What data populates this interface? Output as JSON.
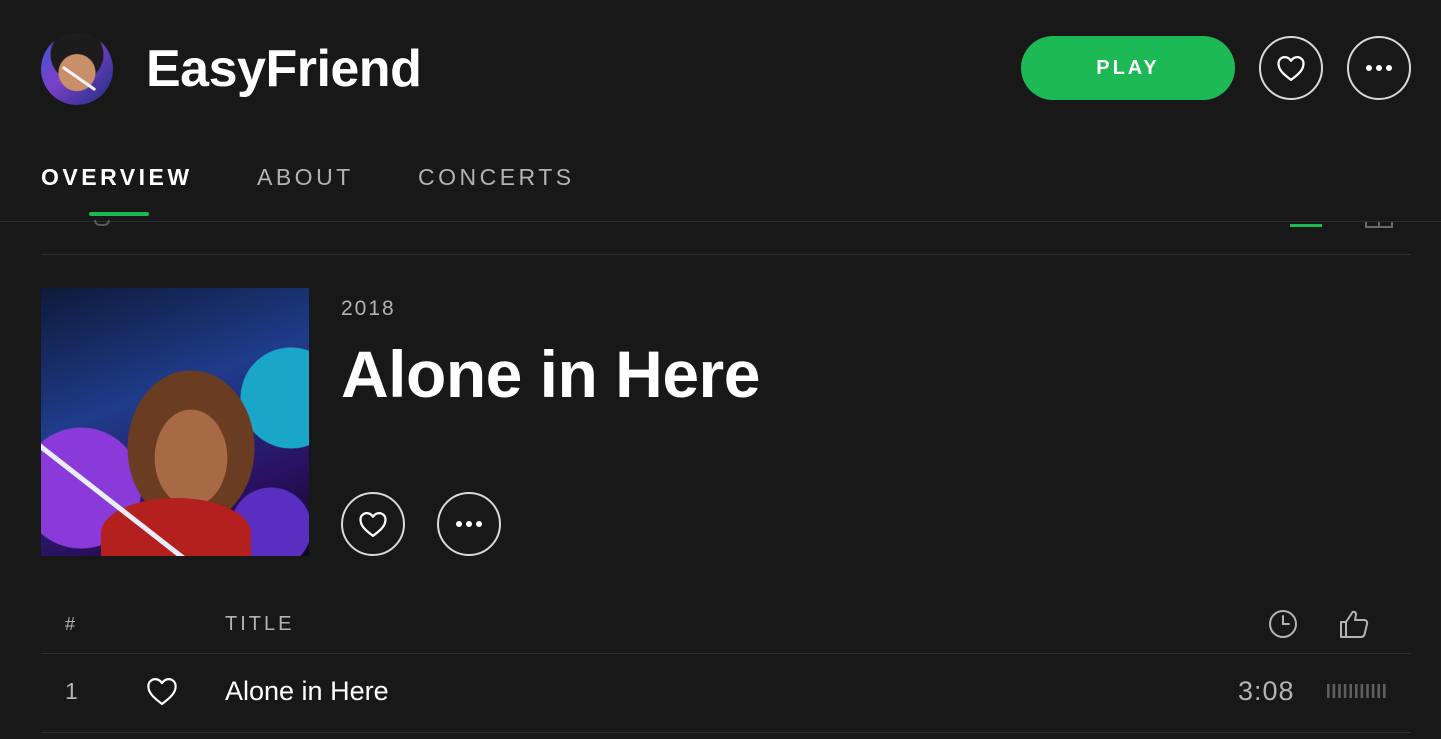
{
  "artist": {
    "name": "EasyFriend"
  },
  "header": {
    "play_label": "PLAY",
    "follow_icon": "heart-icon",
    "more_icon": "more-icon"
  },
  "tabs": [
    {
      "label": "OVERVIEW",
      "active": true
    },
    {
      "label": "ABOUT",
      "active": false
    },
    {
      "label": "CONCERTS",
      "active": false
    }
  ],
  "album": {
    "year": "2018",
    "title": "Alone in Here",
    "like_icon": "heart-icon",
    "more_icon": "more-icon"
  },
  "track_list": {
    "columns": {
      "number": "#",
      "title": "TITLE",
      "duration_icon": "clock-icon",
      "popularity_icon": "thumbs-up-icon"
    },
    "tracks": [
      {
        "number": "1",
        "title": "Alone in Here",
        "duration": "3:08",
        "popularity": 0
      }
    ]
  },
  "colors": {
    "background": "#181818",
    "accent": "#1db954",
    "text_primary": "#ffffff",
    "text_secondary": "#b3b3b3"
  }
}
